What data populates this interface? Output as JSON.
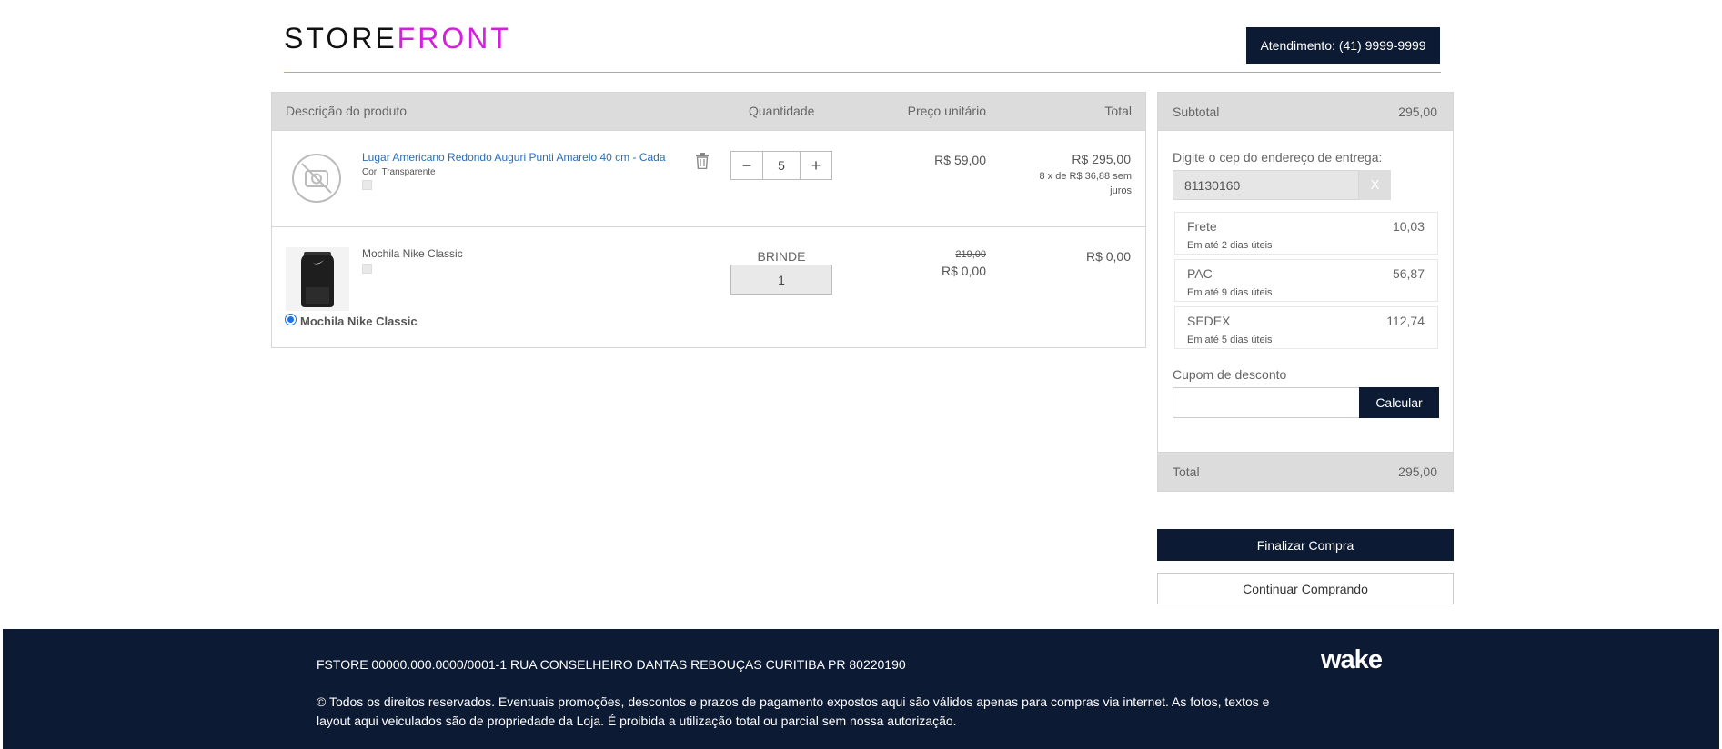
{
  "header": {
    "logo_part1": "STORE",
    "logo_part2": "FRONT",
    "atendimento": "Atendimento: (41) 9999-9999"
  },
  "cart": {
    "columns": {
      "descricao": "Descrição do produto",
      "quantidade": "Quantidade",
      "preco": "Preço unitário",
      "total": "Total"
    },
    "items": [
      {
        "name": "Lugar Americano Redondo Auguri Punti Amarelo 40 cm - Cada",
        "attribute": "Cor: Transparente",
        "quantity": "5",
        "unit_price": "R$ 59,00",
        "total": "R$ 295,00",
        "installments": "8 x de R$ 36,88 sem juros"
      },
      {
        "name": "Mochila Nike Classic",
        "tag": "BRINDE",
        "quantity": "1",
        "old_price": "219,00",
        "unit_price": "R$ 0,00",
        "total": "R$ 0,00",
        "gift_option": "Mochila Nike Classic"
      }
    ]
  },
  "summary": {
    "subtotal_label": "Subtotal",
    "subtotal_value": "295,00",
    "cep_prompt": "Digite o cep do endereço de entrega:",
    "cep_value": "81130160",
    "cep_clear": "X",
    "shipping": [
      {
        "name": "Frete",
        "deadline": "Em até 2 dias úteis",
        "price": "10,03"
      },
      {
        "name": "PAC",
        "deadline": "Em até 9 dias úteis",
        "price": "56,87"
      },
      {
        "name": "SEDEX",
        "deadline": "Em até 5 dias úteis",
        "price": "112,74"
      }
    ],
    "coupon_label": "Cupom de desconto",
    "coupon_value": "",
    "calc_button": "Calcular",
    "total_label": "Total",
    "total_value": "295,00"
  },
  "actions": {
    "finalize": "Finalizar Compra",
    "continue": "Continuar Comprando"
  },
  "footer": {
    "address": "FSTORE 00000.000.0000/0001-1 RUA CONSELHEIRO DANTAS REBOUÇAS CURITIBA PR 80220190",
    "copyright": "© Todos os direitos reservados. Eventuais promoções, descontos e prazos de pagamento expostos aqui são válidos apenas para compras via internet. As fotos, textos e layout aqui veiculados são de propriedade da Loja. É proibida a utilização total ou parcial sem nossa autorização.",
    "brand": "wake"
  },
  "colors": {
    "navy": "#0c1a33",
    "accent_magenta": "#d61ee0",
    "link_blue": "#2c6db3",
    "divider_green": "#a3c43a"
  }
}
